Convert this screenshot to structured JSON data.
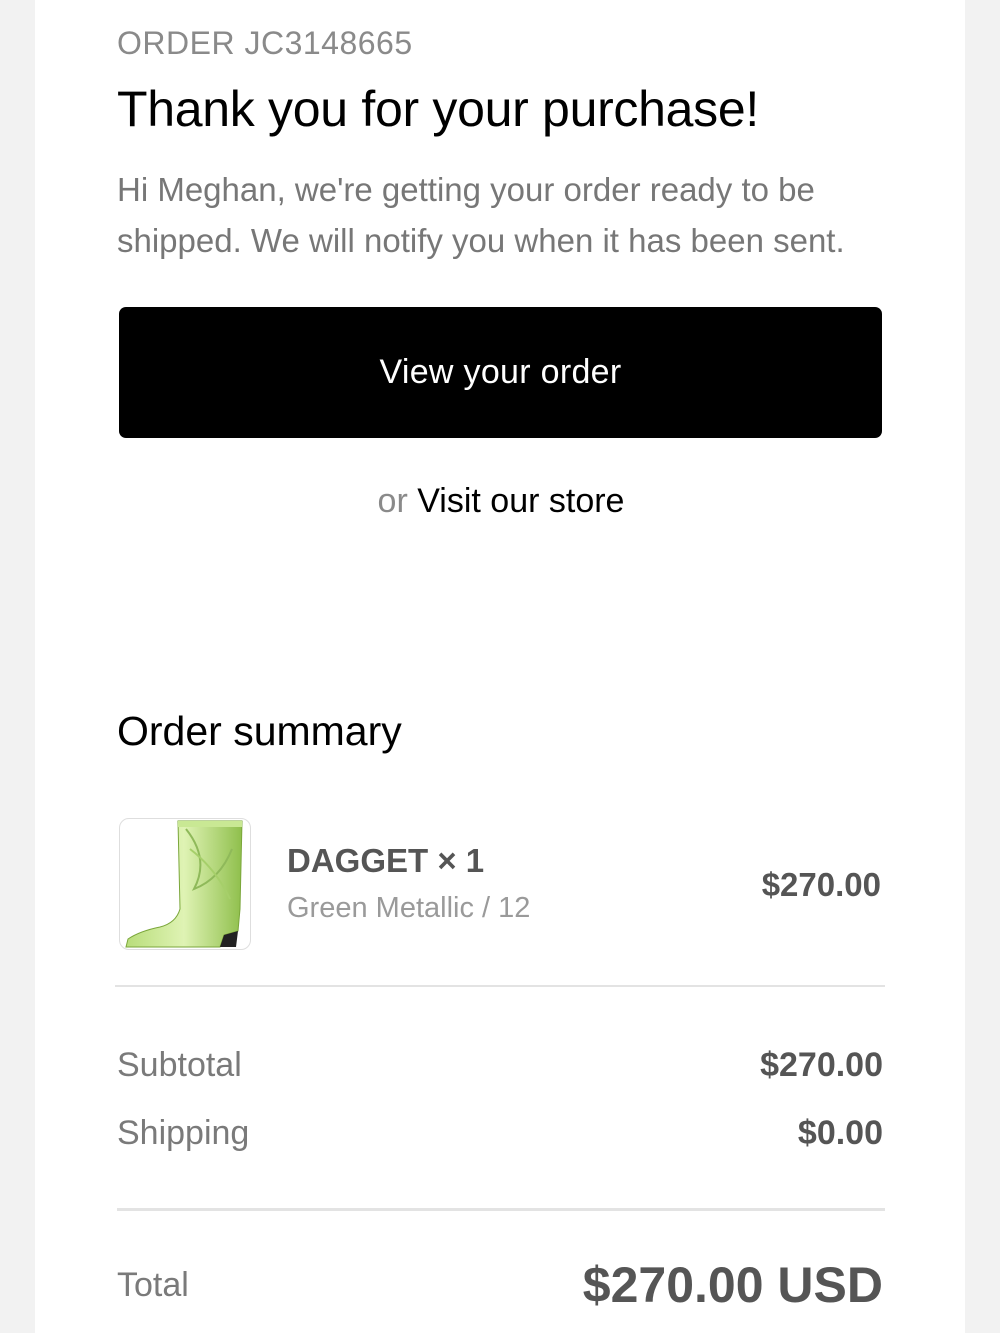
{
  "header": {
    "order_number": "ORDER JC3148665",
    "title": "Thank you for your purchase!",
    "message": "Hi Meghan, we're getting your order ready to be shipped. We will notify you when it has been sent."
  },
  "actions": {
    "view_order_label": "View your order",
    "or_text": "or",
    "visit_store_label": "Visit our store"
  },
  "summary": {
    "title": "Order summary",
    "items": [
      {
        "name": "DAGGET × 1",
        "variant": "Green Metallic / 12",
        "price": "$270.00",
        "image_icon": "green-cowboy-boot-icon"
      }
    ],
    "subtotal_label": "Subtotal",
    "subtotal_value": "$270.00",
    "shipping_label": "Shipping",
    "shipping_value": "$0.00",
    "total_label": "Total",
    "total_value": "$270.00 USD"
  },
  "colors": {
    "button_bg": "#000000",
    "muted_text": "#8a8a8a",
    "price_text": "#555555",
    "boot_green": "#9ccc5a"
  }
}
